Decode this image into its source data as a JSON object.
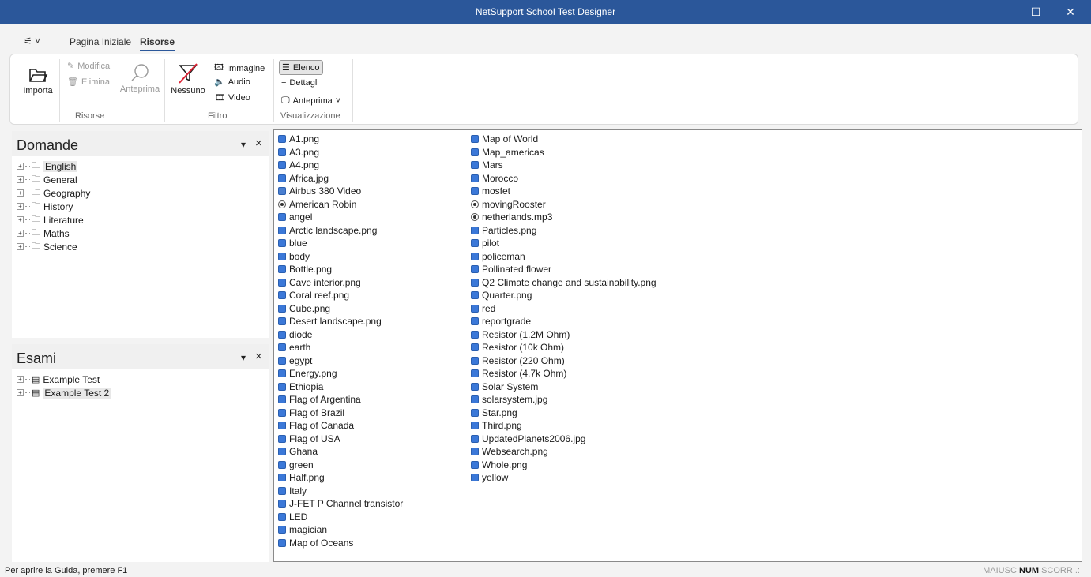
{
  "window": {
    "title": "NetSupport School Test Designer",
    "minimize": "—",
    "maximize": "☐",
    "close": "✕"
  },
  "tabs": {
    "quick_access": "⚟ ˅",
    "home": "Pagina Iniziale",
    "resources": "Risorse"
  },
  "ribbon": {
    "import": "Importa",
    "edit": "Modifica",
    "delete": "Elimina",
    "preview": "Anteprima",
    "none": "Nessuno",
    "image": "Immagine",
    "audio": "Audio",
    "video": "Video",
    "list": "Elenco",
    "details": "Dettagli",
    "preview_dropdown": "Anteprima",
    "group_resources": "Risorse",
    "group_filter": "Filtro",
    "group_view": "Visualizzazione"
  },
  "questions_panel": {
    "title": "Domande",
    "pin": "▾",
    "close": "×",
    "items": [
      {
        "label": "English",
        "selected": true
      },
      {
        "label": "General"
      },
      {
        "label": "Geography"
      },
      {
        "label": "History"
      },
      {
        "label": "Literature"
      },
      {
        "label": "Maths"
      },
      {
        "label": "Science"
      }
    ]
  },
  "exams_panel": {
    "title": "Esami",
    "pin": "▾",
    "close": "×",
    "items": [
      {
        "label": "Example Test"
      },
      {
        "label": "Example Test 2",
        "selected": true
      }
    ]
  },
  "resources": {
    "column1": [
      {
        "name": "A1.png",
        "type": "img"
      },
      {
        "name": "A3.png",
        "type": "img"
      },
      {
        "name": "A4.png",
        "type": "img"
      },
      {
        "name": "Africa.jpg",
        "type": "img"
      },
      {
        "name": "Airbus 380 Video",
        "type": "video"
      },
      {
        "name": "American Robin",
        "type": "audio"
      },
      {
        "name": "angel",
        "type": "img"
      },
      {
        "name": "Arctic landscape.png",
        "type": "img"
      },
      {
        "name": "blue",
        "type": "img"
      },
      {
        "name": "body",
        "type": "img"
      },
      {
        "name": "Bottle.png",
        "type": "img"
      },
      {
        "name": "Cave interior.png",
        "type": "img"
      },
      {
        "name": "Coral reef.png",
        "type": "img"
      },
      {
        "name": "Cube.png",
        "type": "img"
      },
      {
        "name": "Desert landscape.png",
        "type": "img"
      },
      {
        "name": "diode",
        "type": "img"
      },
      {
        "name": "earth",
        "type": "img"
      },
      {
        "name": "egypt",
        "type": "img"
      },
      {
        "name": "Energy.png",
        "type": "img"
      },
      {
        "name": "Ethiopia",
        "type": "img"
      },
      {
        "name": "Flag of Argentina",
        "type": "img"
      },
      {
        "name": "Flag of Brazil",
        "type": "img"
      },
      {
        "name": "Flag of Canada",
        "type": "img"
      },
      {
        "name": "Flag of USA",
        "type": "img"
      },
      {
        "name": "Ghana",
        "type": "img"
      },
      {
        "name": "green",
        "type": "img"
      },
      {
        "name": "Half.png",
        "type": "img"
      },
      {
        "name": "Italy",
        "type": "img"
      },
      {
        "name": "J-FET P Channel  transistor",
        "type": "img"
      },
      {
        "name": "LED",
        "type": "img"
      },
      {
        "name": "magician",
        "type": "img"
      },
      {
        "name": "Map of Oceans",
        "type": "img"
      }
    ],
    "column2": [
      {
        "name": "Map of World",
        "type": "img"
      },
      {
        "name": "Map_americas",
        "type": "img"
      },
      {
        "name": "Mars",
        "type": "img"
      },
      {
        "name": "Morocco",
        "type": "img"
      },
      {
        "name": "mosfet",
        "type": "img"
      },
      {
        "name": "movingRooster",
        "type": "audio"
      },
      {
        "name": "netherlands.mp3",
        "type": "audio"
      },
      {
        "name": "Particles.png",
        "type": "img"
      },
      {
        "name": "pilot",
        "type": "img"
      },
      {
        "name": "policeman",
        "type": "img"
      },
      {
        "name": "Pollinated flower",
        "type": "img"
      },
      {
        "name": "Q2 Climate change and sustainability.png",
        "type": "img"
      },
      {
        "name": "Quarter.png",
        "type": "img"
      },
      {
        "name": "red",
        "type": "img"
      },
      {
        "name": "reportgrade",
        "type": "img"
      },
      {
        "name": "Resistor (1.2M Ohm)",
        "type": "img"
      },
      {
        "name": "Resistor (10k Ohm)",
        "type": "img"
      },
      {
        "name": "Resistor (220 Ohm)",
        "type": "img"
      },
      {
        "name": "Resistor (4.7k Ohm)",
        "type": "img"
      },
      {
        "name": "Solar System",
        "type": "img"
      },
      {
        "name": "solarsystem.jpg",
        "type": "img"
      },
      {
        "name": "Star.png",
        "type": "img"
      },
      {
        "name": "Third.png",
        "type": "img"
      },
      {
        "name": "UpdatedPlanets2006.jpg",
        "type": "img"
      },
      {
        "name": "Websearch.png",
        "type": "img"
      },
      {
        "name": "Whole.png",
        "type": "img"
      },
      {
        "name": "yellow",
        "type": "img"
      }
    ]
  },
  "status": {
    "help": "Per aprire la Guida, premere F1",
    "caps": "MAIUSC",
    "num": "NUM",
    "scroll": "SCORR",
    "grip": ".:"
  },
  "colors": {
    "titlebar": "#2b579a",
    "resource_icon": "#3b78d8"
  }
}
